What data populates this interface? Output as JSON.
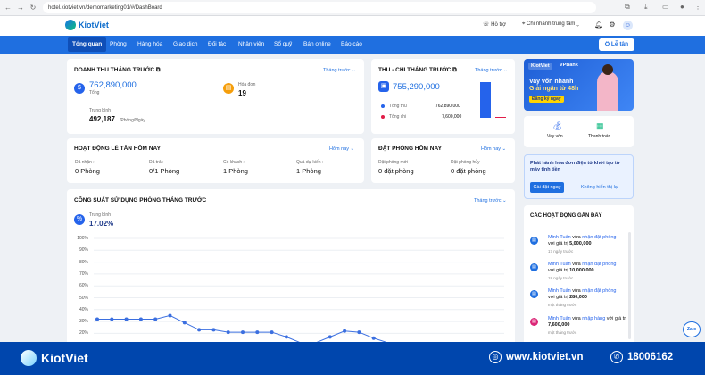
{
  "browser": {
    "url": "hotel.kiotviet.vn/demomarketing01/#/DashBoard"
  },
  "topbar": {
    "logo": "KiotViet",
    "help": "Hỗ trợ",
    "branch": "Chi nhánh trung tâm"
  },
  "nav": {
    "tabs": [
      "Tổng quan",
      "Phòng",
      "Hàng hóa",
      "Giao dịch",
      "Đối tác",
      "Nhân viên",
      "Sổ quỹ",
      "Bán online",
      "Báo cáo"
    ],
    "reception": "Lễ tân"
  },
  "revenue": {
    "title": "DOANH THU THÁNG TRƯỚC",
    "period": "Tháng trước",
    "total_value": "762,890,000",
    "total_label": "Tổng",
    "invoice_label": "Hóa đơn",
    "invoice_count": "19",
    "avg_label": "Trung bình",
    "avg_value": "492,187",
    "avg_unit": "/Phòng/Ngày"
  },
  "cashflow": {
    "title": "THU - CHI THÁNG TRƯỚC",
    "period": "Tháng trước",
    "value": "755,290,000",
    "income_label": "Tổng thu",
    "income": "762,890,000",
    "expense_label": "Tổng chi",
    "expense": "7,600,000",
    "income_color": "#2563eb",
    "expense_color": "#e11d48"
  },
  "reception": {
    "title": "HOẠT ĐỘNG LỄ TÂN HÔM NAY",
    "period": "Hôm nay",
    "items": [
      {
        "label": "Đã nhận",
        "value": "0 Phòng"
      },
      {
        "label": "Đã trả",
        "value": "0/1 Phòng"
      },
      {
        "label": "Có khách",
        "value": "1 Phòng"
      },
      {
        "label": "Quá dự kiến",
        "value": "1 Phòng"
      }
    ]
  },
  "booking": {
    "title": "ĐẶT PHÒNG HÔM NAY",
    "period": "Hôm nay",
    "items": [
      {
        "label": "Đặt phòng mới",
        "value": "0 đặt phòng"
      },
      {
        "label": "Đặt phòng hủy",
        "value": "0 đặt phòng"
      }
    ]
  },
  "occupancy": {
    "title": "CÔNG SUẤT SỬ DỤNG PHÒNG THÁNG TRƯỚC",
    "period": "Tháng trước",
    "avg_label": "Trung bình",
    "avg_value": "17.02%"
  },
  "chart_data": {
    "type": "line",
    "y_ticks": [
      "100%",
      "90%",
      "80%",
      "70%",
      "60%",
      "50%",
      "40%",
      "30%",
      "20%"
    ],
    "ylim": [
      0,
      100
    ],
    "values": [
      32,
      32,
      32,
      32,
      32,
      35,
      29,
      23,
      23,
      21,
      21,
      21,
      21,
      17,
      12,
      12,
      17,
      22,
      21,
      16,
      12
    ]
  },
  "promo": {
    "brand1": "KiotViet",
    "brand2": "VPBank",
    "line1": "Vay vốn nhanh",
    "line2": "Giải ngân từ 48h",
    "cta": "Đăng ký ngay"
  },
  "quick": {
    "loan": "Vay vốn",
    "payment": "Thanh toán"
  },
  "einvoice": {
    "text": "Phát hành hóa đơn điện tử khởi tạo từ máy tính tiền",
    "setup": "Cài đặt ngay",
    "hide": "Không hiển thị lại"
  },
  "activities": {
    "title": "CÁC HOẠT ĐỘNG GẦN ĐÂY",
    "items": [
      {
        "user": "Minh Tuấn",
        "verb": "vừa",
        "action": "nhận đặt phòng",
        "amount_prefix": "với giá trị",
        "amount": "5,000,000",
        "time": "17 ngày trước"
      },
      {
        "user": "Minh Tuấn",
        "verb": "vừa",
        "action": "nhận đặt phòng",
        "amount_prefix": "với giá trị",
        "amount": "10,000,000",
        "time": "18 ngày trước"
      },
      {
        "user": "Minh Tuấn",
        "verb": "vừa",
        "action": "nhận đặt phòng",
        "amount_prefix": "với giá trị",
        "amount": "280,000",
        "time": "một tháng trước"
      },
      {
        "user": "Minh Tuấn",
        "verb": "vừa",
        "action": "nhập hàng",
        "amount_prefix": "với giá trị",
        "amount": "7,600,000",
        "time": "một tháng trước"
      }
    ]
  },
  "footer": {
    "brand": "KiotViet",
    "website": "www.kiotviet.vn",
    "hotline": "18006162"
  },
  "zalo": "Zalo"
}
